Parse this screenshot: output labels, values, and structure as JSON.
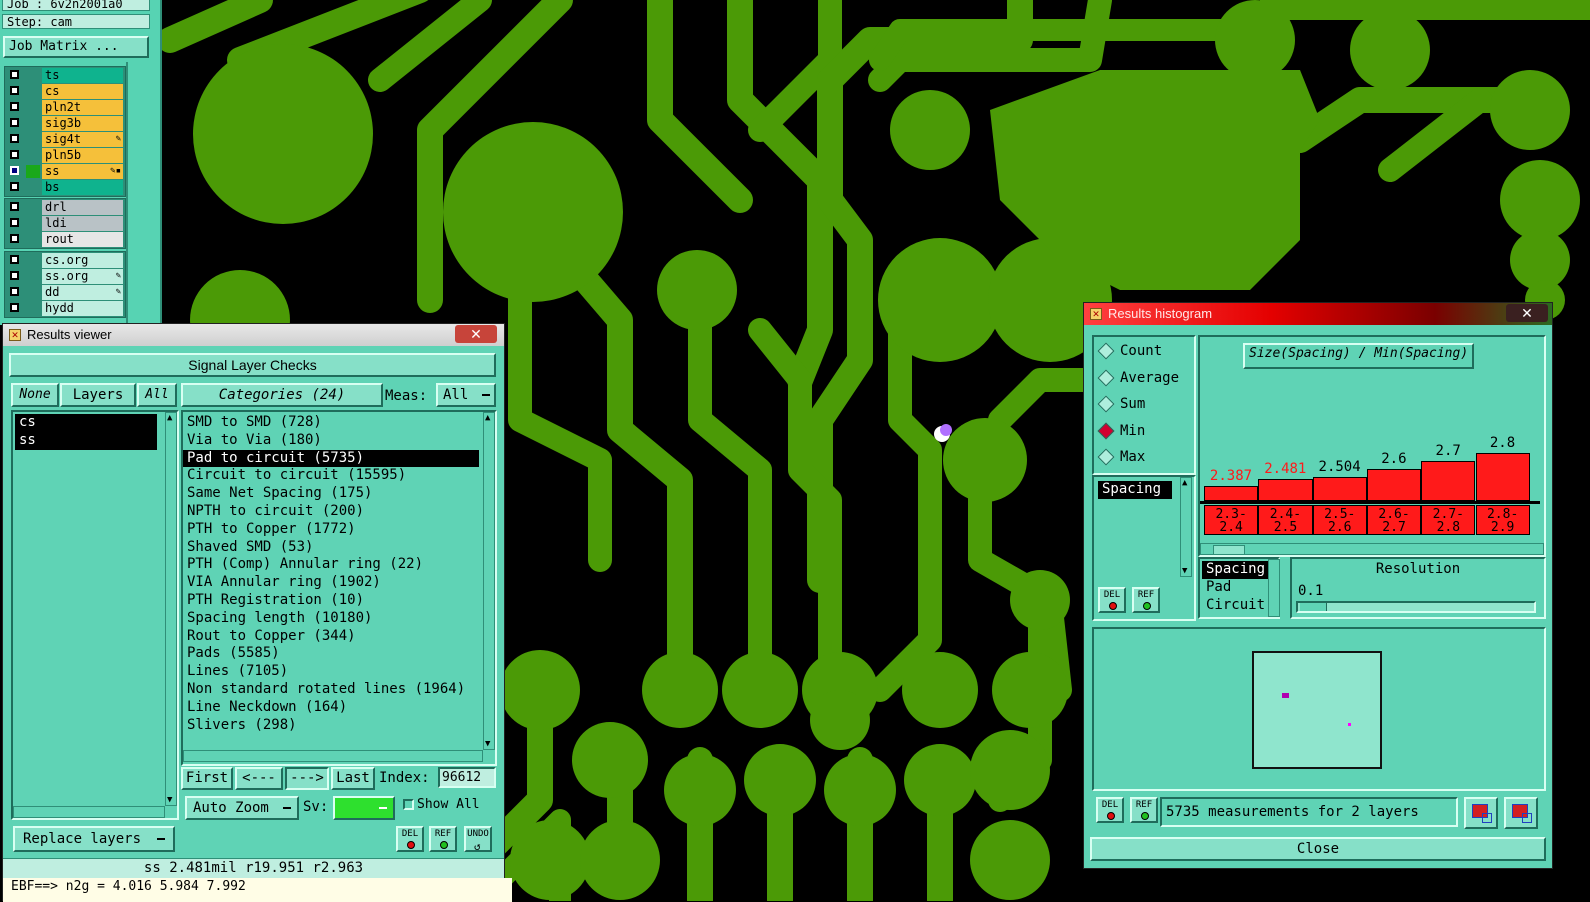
{
  "job_panel": {
    "job_line": "Job : 6v2n2001a0",
    "step_line": "Step: cam",
    "job_matrix_label": "Job Matrix ...",
    "layer_groups": [
      [
        {
          "name": "ts",
          "color": "#0fb38e",
          "selected": false,
          "mark": ""
        },
        {
          "name": "cs",
          "color": "#f5c03a",
          "selected": false,
          "mark": ""
        },
        {
          "name": "pln2t",
          "color": "#f5c03a",
          "selected": false,
          "mark": ""
        },
        {
          "name": "sig3b",
          "color": "#f5c03a",
          "selected": false,
          "mark": ""
        },
        {
          "name": "sig4t",
          "color": "#f5c03a",
          "selected": false,
          "mark": "✎"
        },
        {
          "name": "pln5b",
          "color": "#f5c03a",
          "selected": false,
          "mark": ""
        },
        {
          "name": "ss",
          "color": "#f5c03a",
          "selected": true,
          "mark": "✎▪"
        },
        {
          "name": "bs",
          "color": "#0fb38e",
          "selected": false,
          "mark": ""
        }
      ],
      [
        {
          "name": "drl",
          "color": "#b9c2c6",
          "selected": false,
          "mark": ""
        },
        {
          "name": "ldi",
          "color": "#b9c2c6",
          "selected": false,
          "mark": ""
        },
        {
          "name": "rout",
          "color": "#e6e6e6",
          "selected": false,
          "mark": ""
        }
      ],
      [
        {
          "name": "cs.org",
          "color": "#bfeee0",
          "selected": false,
          "mark": ""
        },
        {
          "name": "ss.org",
          "color": "#bfeee0",
          "selected": false,
          "mark": "✎"
        },
        {
          "name": "dd",
          "color": "#bfeee0",
          "selected": false,
          "mark": "✎"
        },
        {
          "name": "hydd",
          "color": "#bfeee0",
          "selected": false,
          "mark": ""
        }
      ]
    ]
  },
  "results_viewer": {
    "title": "Results viewer",
    "close_symbol": "✕",
    "header": "Signal Layer Checks",
    "none_label": "None",
    "layers_label": "Layers",
    "all_label": "All",
    "layers": [
      "cs",
      "ss"
    ],
    "categories_label": "Categories (24)",
    "meas_label": "Meas:",
    "meas_value": "All",
    "categories": [
      "SMD to SMD (728)",
      "Via to Via (180)",
      "Pad to circuit (5735)",
      "Circuit to circuit (15595)",
      "Same Net Spacing (175)",
      "NPTH to circuit (200)",
      "PTH to Copper (1772)",
      "Shaved SMD (53)",
      "PTH (Comp) Annular ring (22)",
      "VIA Annular ring (1902)",
      "PTH Registration (10)",
      "Spacing length (10180)",
      "Rout to Copper (344)",
      "Pads (5585)",
      "Lines (7105)",
      "Non standard rotated lines (1964)",
      "Line Neckdown (164)",
      "Slivers (298)"
    ],
    "selected_category": 2,
    "first_label": "First",
    "prev_label": "<---",
    "next_label": "--->",
    "last_label": "Last",
    "index_label": "Index:",
    "index_value": "96612",
    "auto_zoom_label": "Auto Zoom",
    "sv_label": "Sv:",
    "show_all_label": "Show All",
    "replace_layers_label": "Replace layers",
    "del_label": "DEL",
    "ref_label": "REF",
    "undo_label": "UNDO",
    "status_text": "ss 2.481mil  r19.951  r2.963"
  },
  "command_line": "EBF==> n2g = 4.016 5.984 7.992",
  "histogram": {
    "title": "Results histogram",
    "close_symbol": "✕",
    "modes": [
      {
        "label": "Count",
        "on": false
      },
      {
        "label": "Average",
        "on": false
      },
      {
        "label": "Sum",
        "on": false
      },
      {
        "label": "Min",
        "on": true
      },
      {
        "label": "Max",
        "on": false
      }
    ],
    "attr_list": [
      "Spacing"
    ],
    "chart_title": "Size(Spacing) / Min(Spacing)",
    "bars": [
      {
        "value": "2.387",
        "range": "2.3-2.4",
        "red": true
      },
      {
        "value": "2.481",
        "range": "2.4-2.5",
        "red": true
      },
      {
        "value": "2.504",
        "range": "2.5-2.6",
        "red": false
      },
      {
        "value": "2.6",
        "range": "2.6-2.7",
        "red": false
      },
      {
        "value": "2.7",
        "range": "2.7-2.8",
        "red": false
      },
      {
        "value": "2.8",
        "range": "2.8-2.9",
        "red": false
      }
    ],
    "field_list": [
      "Spacing",
      "Pad",
      "Circuit"
    ],
    "resolution_label": "Resolution",
    "resolution_value": "0.1",
    "summary": "5735 measurements for 2 layers",
    "close_label": "Close",
    "del_label": "DEL",
    "ref_label": "REF"
  }
}
